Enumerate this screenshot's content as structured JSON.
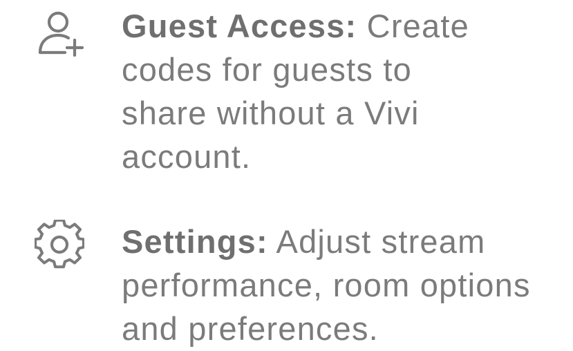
{
  "features": {
    "guest": {
      "icon": "add-user-icon",
      "title": "Guest Access:",
      "description": "Create codes for guests to share without a Vivi account."
    },
    "settings": {
      "icon": "gear-icon",
      "title": "Settings:",
      "description": "Adjust stream performance, room options and preferences."
    }
  },
  "colors": {
    "text": "#7b7b7b",
    "icon": "#7b7b7b",
    "background": "#ffffff"
  }
}
